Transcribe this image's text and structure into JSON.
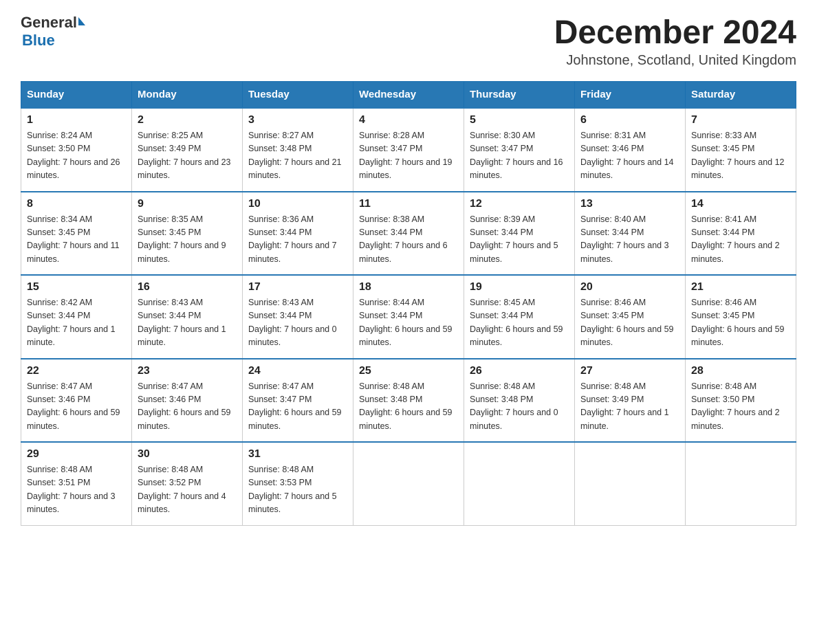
{
  "header": {
    "logo_general": "General",
    "logo_blue": "Blue",
    "month_title": "December 2024",
    "location": "Johnstone, Scotland, United Kingdom"
  },
  "weekdays": [
    "Sunday",
    "Monday",
    "Tuesday",
    "Wednesday",
    "Thursday",
    "Friday",
    "Saturday"
  ],
  "weeks": [
    [
      {
        "day": "1",
        "sunrise": "8:24 AM",
        "sunset": "3:50 PM",
        "daylight": "7 hours and 26 minutes."
      },
      {
        "day": "2",
        "sunrise": "8:25 AM",
        "sunset": "3:49 PM",
        "daylight": "7 hours and 23 minutes."
      },
      {
        "day": "3",
        "sunrise": "8:27 AM",
        "sunset": "3:48 PM",
        "daylight": "7 hours and 21 minutes."
      },
      {
        "day": "4",
        "sunrise": "8:28 AM",
        "sunset": "3:47 PM",
        "daylight": "7 hours and 19 minutes."
      },
      {
        "day": "5",
        "sunrise": "8:30 AM",
        "sunset": "3:47 PM",
        "daylight": "7 hours and 16 minutes."
      },
      {
        "day": "6",
        "sunrise": "8:31 AM",
        "sunset": "3:46 PM",
        "daylight": "7 hours and 14 minutes."
      },
      {
        "day": "7",
        "sunrise": "8:33 AM",
        "sunset": "3:45 PM",
        "daylight": "7 hours and 12 minutes."
      }
    ],
    [
      {
        "day": "8",
        "sunrise": "8:34 AM",
        "sunset": "3:45 PM",
        "daylight": "7 hours and 11 minutes."
      },
      {
        "day": "9",
        "sunrise": "8:35 AM",
        "sunset": "3:45 PM",
        "daylight": "7 hours and 9 minutes."
      },
      {
        "day": "10",
        "sunrise": "8:36 AM",
        "sunset": "3:44 PM",
        "daylight": "7 hours and 7 minutes."
      },
      {
        "day": "11",
        "sunrise": "8:38 AM",
        "sunset": "3:44 PM",
        "daylight": "7 hours and 6 minutes."
      },
      {
        "day": "12",
        "sunrise": "8:39 AM",
        "sunset": "3:44 PM",
        "daylight": "7 hours and 5 minutes."
      },
      {
        "day": "13",
        "sunrise": "8:40 AM",
        "sunset": "3:44 PM",
        "daylight": "7 hours and 3 minutes."
      },
      {
        "day": "14",
        "sunrise": "8:41 AM",
        "sunset": "3:44 PM",
        "daylight": "7 hours and 2 minutes."
      }
    ],
    [
      {
        "day": "15",
        "sunrise": "8:42 AM",
        "sunset": "3:44 PM",
        "daylight": "7 hours and 1 minute."
      },
      {
        "day": "16",
        "sunrise": "8:43 AM",
        "sunset": "3:44 PM",
        "daylight": "7 hours and 1 minute."
      },
      {
        "day": "17",
        "sunrise": "8:43 AM",
        "sunset": "3:44 PM",
        "daylight": "7 hours and 0 minutes."
      },
      {
        "day": "18",
        "sunrise": "8:44 AM",
        "sunset": "3:44 PM",
        "daylight": "6 hours and 59 minutes."
      },
      {
        "day": "19",
        "sunrise": "8:45 AM",
        "sunset": "3:44 PM",
        "daylight": "6 hours and 59 minutes."
      },
      {
        "day": "20",
        "sunrise": "8:46 AM",
        "sunset": "3:45 PM",
        "daylight": "6 hours and 59 minutes."
      },
      {
        "day": "21",
        "sunrise": "8:46 AM",
        "sunset": "3:45 PM",
        "daylight": "6 hours and 59 minutes."
      }
    ],
    [
      {
        "day": "22",
        "sunrise": "8:47 AM",
        "sunset": "3:46 PM",
        "daylight": "6 hours and 59 minutes."
      },
      {
        "day": "23",
        "sunrise": "8:47 AM",
        "sunset": "3:46 PM",
        "daylight": "6 hours and 59 minutes."
      },
      {
        "day": "24",
        "sunrise": "8:47 AM",
        "sunset": "3:47 PM",
        "daylight": "6 hours and 59 minutes."
      },
      {
        "day": "25",
        "sunrise": "8:48 AM",
        "sunset": "3:48 PM",
        "daylight": "6 hours and 59 minutes."
      },
      {
        "day": "26",
        "sunrise": "8:48 AM",
        "sunset": "3:48 PM",
        "daylight": "7 hours and 0 minutes."
      },
      {
        "day": "27",
        "sunrise": "8:48 AM",
        "sunset": "3:49 PM",
        "daylight": "7 hours and 1 minute."
      },
      {
        "day": "28",
        "sunrise": "8:48 AM",
        "sunset": "3:50 PM",
        "daylight": "7 hours and 2 minutes."
      }
    ],
    [
      {
        "day": "29",
        "sunrise": "8:48 AM",
        "sunset": "3:51 PM",
        "daylight": "7 hours and 3 minutes."
      },
      {
        "day": "30",
        "sunrise": "8:48 AM",
        "sunset": "3:52 PM",
        "daylight": "7 hours and 4 minutes."
      },
      {
        "day": "31",
        "sunrise": "8:48 AM",
        "sunset": "3:53 PM",
        "daylight": "7 hours and 5 minutes."
      },
      null,
      null,
      null,
      null
    ]
  ]
}
